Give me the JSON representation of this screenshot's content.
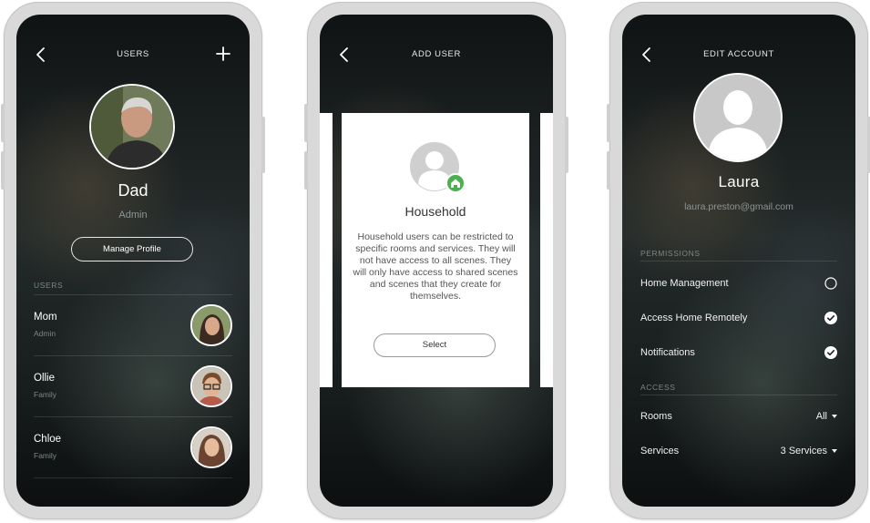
{
  "colors": {
    "accent_green": "#4caf50",
    "screen_bg": "#1b2021",
    "card_bg": "#ffffff"
  },
  "users_screen": {
    "title": "USERS",
    "back_icon": "chevron-left-icon",
    "add_icon": "plus-icon",
    "profile": {
      "name": "Dad",
      "role": "Admin"
    },
    "manage_profile_label": "Manage Profile",
    "section_label": "USERS",
    "users": [
      {
        "name": "Mom",
        "role": "Admin"
      },
      {
        "name": "Ollie",
        "role": "Family"
      },
      {
        "name": "Chloe",
        "role": "Family"
      }
    ]
  },
  "add_user_screen": {
    "title": "ADD USER",
    "back_icon": "chevron-left-icon",
    "card": {
      "badge_icon": "home-icon",
      "title": "Household",
      "description": "Household users can be restricted to specific rooms and services. They will not have access to all scenes. They will only have access to shared scenes and scenes that they create for themselves.",
      "select_label": "Select"
    }
  },
  "edit_account_screen": {
    "title": "EDIT ACCOUNT",
    "back_icon": "chevron-left-icon",
    "name": "Laura",
    "email": "laura.preston@gmail.com",
    "permissions_label": "PERMISSIONS",
    "permissions": [
      {
        "label": "Home Management",
        "checked": false
      },
      {
        "label": "Access Home Remotely",
        "checked": true
      },
      {
        "label": "Notifications",
        "checked": true
      }
    ],
    "access_label": "ACCESS",
    "access": [
      {
        "label": "Rooms",
        "value": "All"
      },
      {
        "label": "Services",
        "value": "3 Services"
      }
    ]
  }
}
